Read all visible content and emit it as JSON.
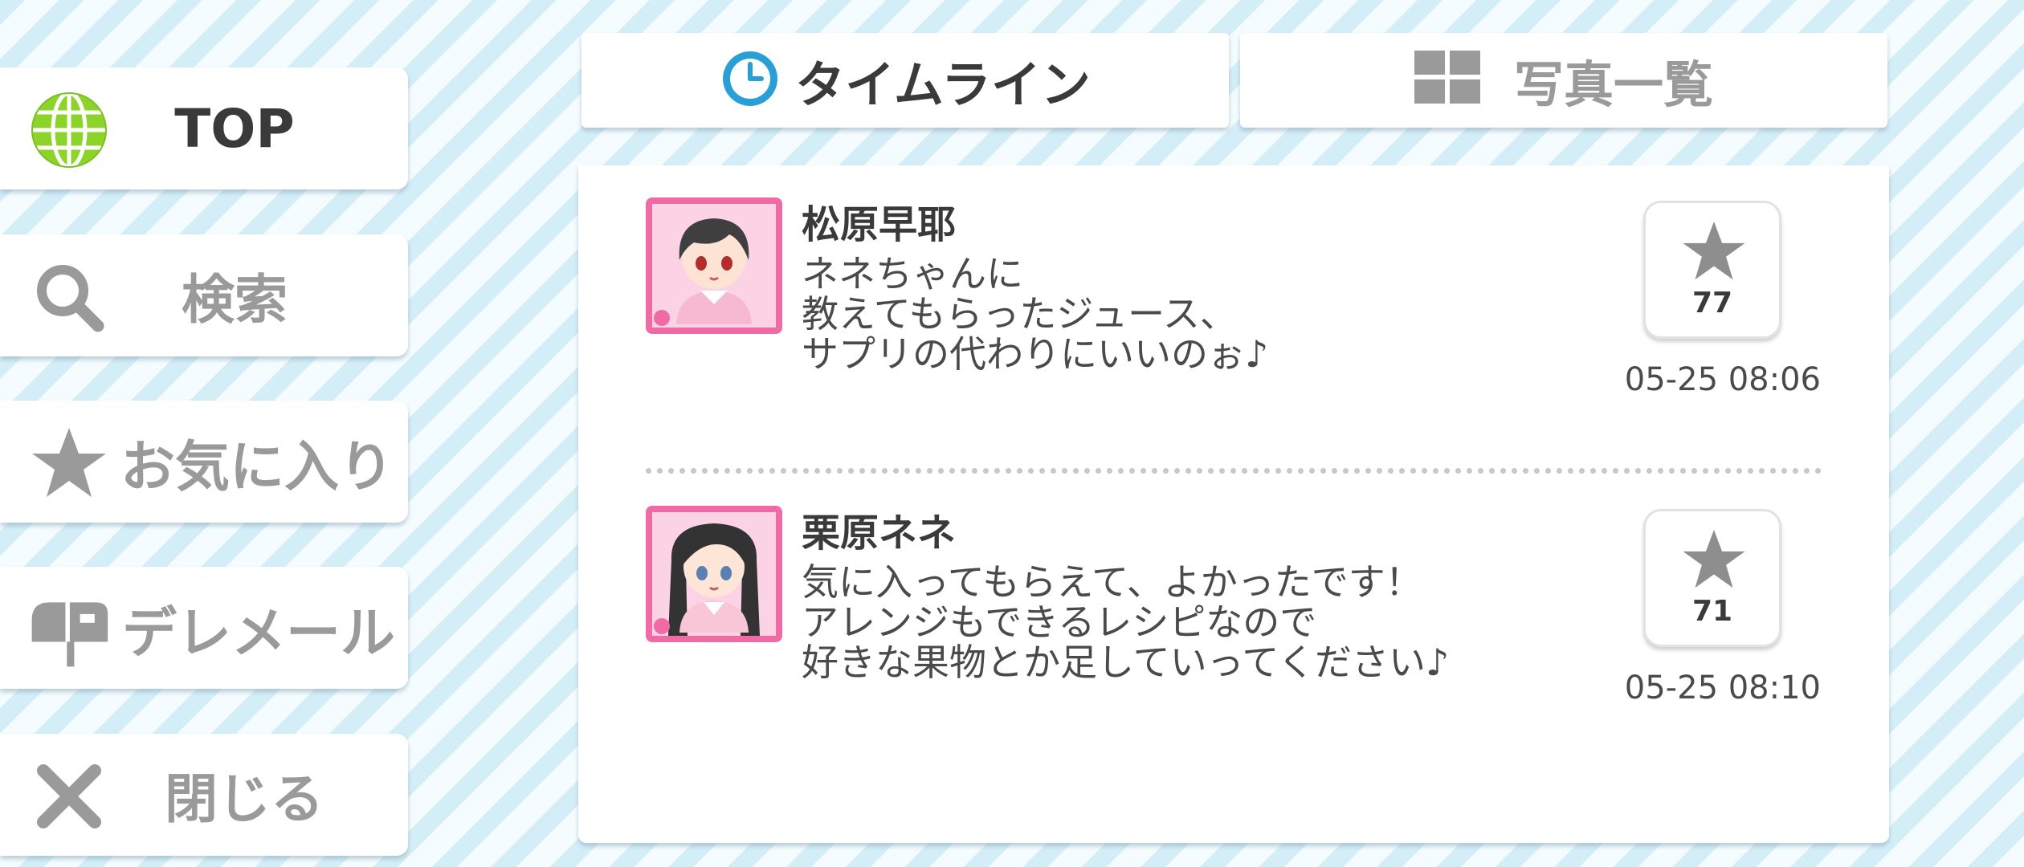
{
  "sidebar": {
    "items": [
      {
        "label": "TOP",
        "icon": "globe-icon"
      },
      {
        "label": "検索",
        "icon": "search-icon"
      },
      {
        "label": "お気に入り",
        "icon": "star-icon"
      },
      {
        "label": "デレメール",
        "icon": "mailbox-icon"
      },
      {
        "label": "閉じる",
        "icon": "close-icon"
      }
    ]
  },
  "tabs": [
    {
      "label": "タイムライン",
      "icon": "clock-icon",
      "active": true
    },
    {
      "label": "写真一覧",
      "icon": "grid-icon",
      "active": false
    }
  ],
  "posts": [
    {
      "name": "松原早耶",
      "text": "ネネちゃんに\n教えてもらったジュース、\nサプリの代わりにいいのぉ♪",
      "likes": "77",
      "time": "05-25 08:06",
      "avatar_icon": "character-avatar-icon"
    },
    {
      "name": "栗原ネネ",
      "text": "気に入ってもらえて、よかったです！\nアレンジもできるレシピなので\n好きな果物とか足していってください♪",
      "likes": "71",
      "time": "05-25 08:10",
      "avatar_icon": "character-avatar-icon"
    }
  ],
  "colors": {
    "accent_pink": "#f06aa5",
    "icon_gray": "#9a9a9a",
    "globe_green": "#8cd42a",
    "clock_blue": "#2a9fd6"
  }
}
